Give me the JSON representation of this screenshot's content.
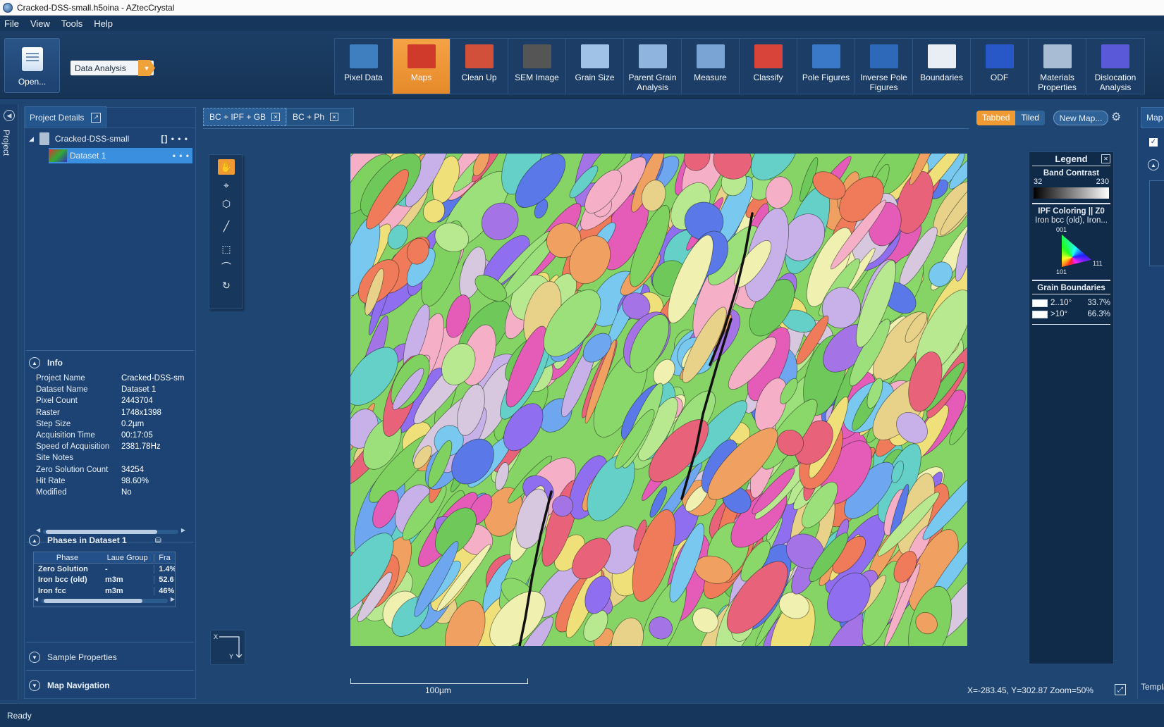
{
  "window": {
    "title": "Cracked-DSS-small.h5oina - AZtecCrystal"
  },
  "menu": [
    "File",
    "View",
    "Tools",
    "Help"
  ],
  "ribbon": {
    "open_label": "Open...",
    "mode": "Data Analysis",
    "tools": [
      {
        "label": "Pixel Data",
        "icon": "pixel-data-icon",
        "color": "#3f7fc0"
      },
      {
        "label": "Maps",
        "icon": "maps-icon",
        "color": "#d03a2a"
      },
      {
        "label": "Clean Up",
        "icon": "clean-up-icon",
        "color": "#d0503a"
      },
      {
        "label": "SEM Image",
        "icon": "sem-image-icon",
        "color": "#555555"
      },
      {
        "label": "Grain Size",
        "icon": "grain-size-icon",
        "color": "#9fc2e6"
      },
      {
        "label": "Parent Grain Analysis",
        "icon": "parent-grain-icon",
        "color": "#8fb5df"
      },
      {
        "label": "Measure",
        "icon": "measure-icon",
        "color": "#7aa4d4"
      },
      {
        "label": "Classify",
        "icon": "classify-icon",
        "color": "#d8433a"
      },
      {
        "label": "Pole Figures",
        "icon": "pole-figures-icon",
        "color": "#3a78c8"
      },
      {
        "label": "Inverse Pole Figures",
        "icon": "inverse-pole-figures-icon",
        "color": "#2e68b8"
      },
      {
        "label": "Boundaries",
        "icon": "boundaries-icon",
        "color": "#e9eef5"
      },
      {
        "label": "ODF",
        "icon": "odf-icon",
        "color": "#2858c8"
      },
      {
        "label": "Materials Properties",
        "icon": "materials-properties-icon",
        "color": "#a8bcd4"
      },
      {
        "label": "Dislocation Analysis",
        "icon": "dislocation-analysis-icon",
        "color": "#5a5ad8"
      }
    ],
    "active_tool": "Maps"
  },
  "side_strip": {
    "label": "Project"
  },
  "project": {
    "tab_label": "Project Details",
    "root_name": "Cracked-DSS-small",
    "dataset_name": "Dataset 1",
    "info_title": "Info",
    "info": [
      {
        "key": "Project Name",
        "value": "Cracked-DSS-sm"
      },
      {
        "key": "Dataset Name",
        "value": "Dataset 1"
      },
      {
        "key": "Pixel Count",
        "value": "2443704"
      },
      {
        "key": "Raster",
        "value": "1748x1398"
      },
      {
        "key": "Step Size",
        "value": "0.2µm"
      },
      {
        "key": "Acquisition Time",
        "value": "00:17:05"
      },
      {
        "key": "Speed of Acquisition",
        "value": "2381.78Hz"
      },
      {
        "key": "Site Notes",
        "value": ""
      },
      {
        "key": "Zero Solution Count",
        "value": "34254"
      },
      {
        "key": "Hit Rate",
        "value": "98.60%"
      },
      {
        "key": "Modified",
        "value": "No"
      }
    ],
    "phases_title": "Phases in Dataset 1",
    "phase_headers": [
      "Phase",
      "Laue Group",
      "Fra"
    ],
    "phases": [
      {
        "phase": "Zero Solution",
        "laue": "-",
        "frac": "1.4%"
      },
      {
        "phase": "Iron bcc (old)",
        "laue": "m3m",
        "frac": "52.6"
      },
      {
        "phase": "Iron fcc",
        "laue": "m3m",
        "frac": "46%"
      }
    ],
    "sample_properties": "Sample Properties",
    "map_navigation": "Map Navigation"
  },
  "doc_tabs": [
    "BC + IPF + GB",
    "BC + Ph"
  ],
  "view_controls": {
    "tabbed": "Tabbed",
    "tiled": "Tiled",
    "new_map": "New Map..."
  },
  "axes": {
    "x": "X",
    "y": "Y"
  },
  "scale_label": "100µm",
  "coordinates": "X=-283.45, Y=302.87 Zoom=50%",
  "legend": {
    "title": "Legend",
    "band_contrast_title": "Band Contrast",
    "bc_min": "32",
    "bc_max": "230",
    "ipf_title": "IPF Coloring || Z0",
    "ipf_subtitle": "Iron bcc (old), Iron...",
    "ipf_labels": {
      "top": "001",
      "right": "111",
      "bottom": "101"
    },
    "gb_title": "Grain Boundaries",
    "gb_rows": [
      {
        "range": "2..10°",
        "pct": "33.7%"
      },
      {
        "range": ">10°",
        "pct": "66.3%"
      }
    ]
  },
  "right_panel": {
    "tab": "Map S",
    "template": "Templa"
  },
  "status": "Ready",
  "colors": {
    "accent": "#f09a34",
    "background": "#1f4672",
    "selection": "#3a8fde"
  }
}
